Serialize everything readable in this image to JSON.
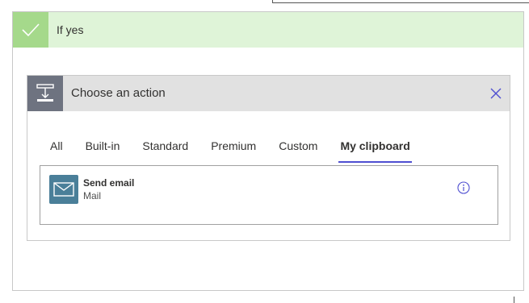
{
  "condition": {
    "label": "If yes",
    "icon": "checkmark-icon",
    "color": "#a5d98b"
  },
  "action_picker": {
    "title": "Choose an action",
    "header_icon": "action-insert-icon",
    "close_icon": "close-icon",
    "tabs": [
      {
        "label": "All",
        "active": false
      },
      {
        "label": "Built-in",
        "active": false
      },
      {
        "label": "Standard",
        "active": false
      },
      {
        "label": "Premium",
        "active": false
      },
      {
        "label": "Custom",
        "active": false
      },
      {
        "label": "My clipboard",
        "active": true
      }
    ],
    "results": [
      {
        "name": "Send email",
        "connector": "Mail",
        "icon": "mail-icon",
        "info_icon": "info-icon"
      }
    ]
  },
  "colors": {
    "accent": "#4f4fd1",
    "mail_icon_bg": "#4a7f99"
  }
}
